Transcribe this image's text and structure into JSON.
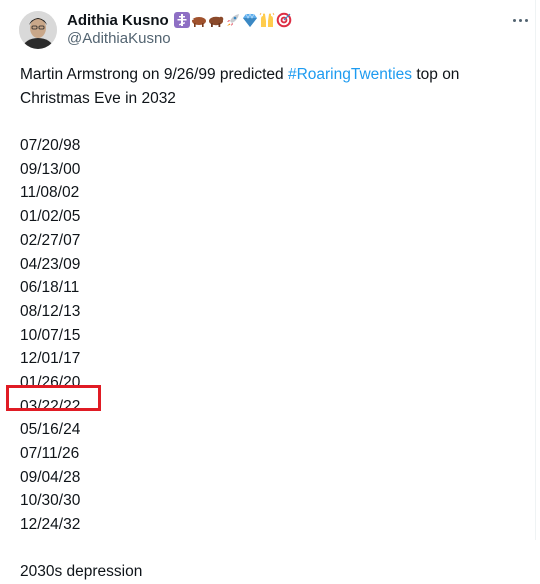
{
  "tweet": {
    "display_name": "Adithia Kusno",
    "handle": "@AdithiaKusno",
    "emoji_icons": [
      "orthodox-cross-icon",
      "bull-icon",
      "bear-icon",
      "rocket-icon",
      "gem-icon",
      "raising-hands-icon",
      "target-icon"
    ],
    "intro_text": "Martin Armstrong on 9/26/99 predicted ",
    "hashtag": "#RoaringTwenties",
    "intro_text_after": " top on Christmas Eve in 2032",
    "dates": [
      "07/20/98",
      "09/13/00",
      "11/08/02",
      "01/02/05",
      "02/27/07",
      "04/23/09",
      "06/18/11",
      "08/12/13",
      "10/07/15",
      "12/01/17",
      "01/26/20",
      "03/22/22",
      "05/16/24",
      "07/11/26",
      "09/04/28",
      "10/30/30",
      "12/24/32"
    ],
    "highlighted_date": "05/16/24",
    "closing_text": "2030s depression"
  },
  "colors": {
    "hashtag": "#1d9bf0",
    "highlight_box": "#e01b24",
    "secondary_text": "#536471"
  }
}
